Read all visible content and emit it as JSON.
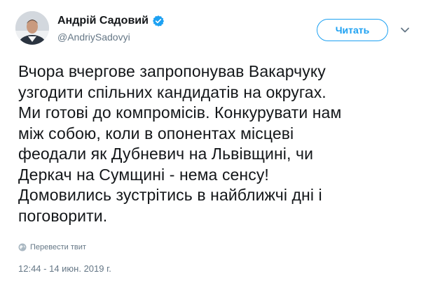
{
  "author": {
    "name": "Андрій Садовий",
    "handle": "@AndriySadovyi",
    "verified": true
  },
  "follow_button": {
    "label": "Читать"
  },
  "tweet": {
    "text": "Вчора вчергове запропонував Вакарчуку\nузгодити спільних кандидатів на округах.\nМи готові до компромісів. Конкурувати нам\nміж собою, коли в опонентах місцеві\nфеодали як Дубневич на Львівщині, чи\nДеркач на Сумщині - нема сенсу!\nДомовились зустрітись в найближчі дні і\nпоговорити."
  },
  "translate_link": "Перевести твит",
  "timestamp": "12:44 - 14 июн. 2019 г.",
  "icons": {
    "verified": "verified-badge-icon",
    "caret": "chevron-down-icon",
    "translate": "globe-icon"
  },
  "colors": {
    "accent": "#1da1f2",
    "secondary_text": "#657786",
    "primary_text": "#14171a"
  }
}
